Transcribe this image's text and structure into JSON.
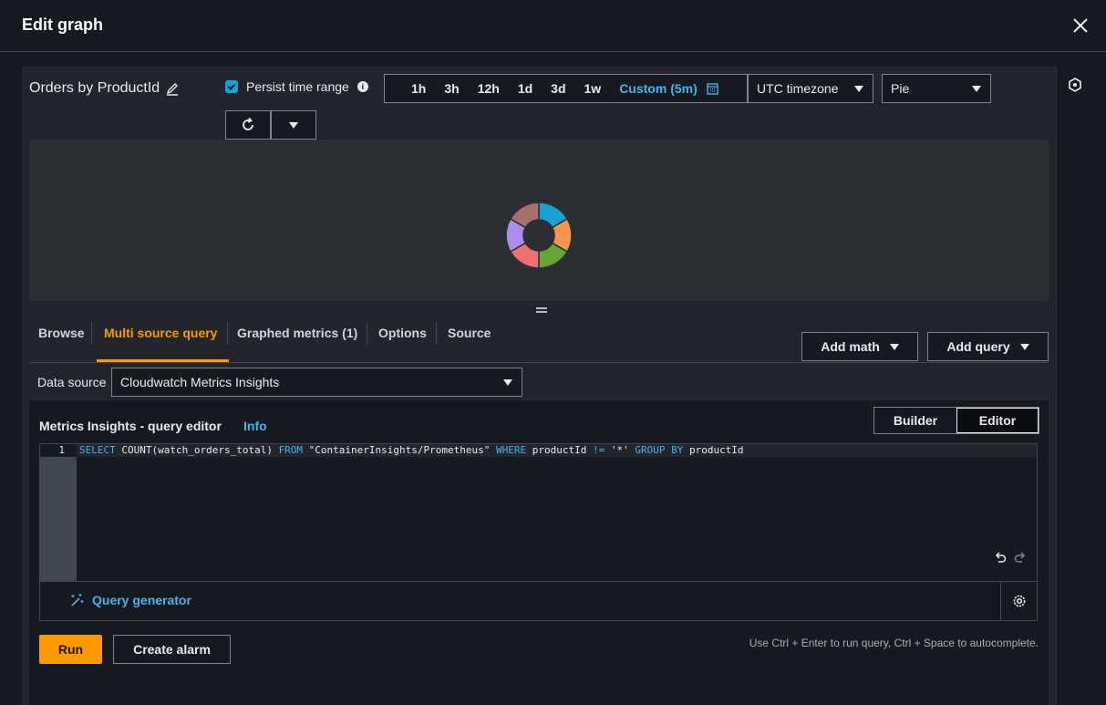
{
  "modal": {
    "title": "Edit graph"
  },
  "graph": {
    "title": "Orders by ProductId"
  },
  "persist": {
    "label": "Persist time range",
    "checked": true
  },
  "time_ranges": [
    "1h",
    "3h",
    "12h",
    "1d",
    "3d",
    "1w"
  ],
  "custom_range": "Custom (5m)",
  "timezone": {
    "selected": "UTC timezone"
  },
  "chart_type": {
    "selected": "Pie"
  },
  "chart_data": {
    "type": "pie",
    "slices": [
      {
        "value": 1,
        "color": "#17a2d3"
      },
      {
        "value": 1,
        "color": "#f5944d"
      },
      {
        "value": 1,
        "color": "#65a637"
      },
      {
        "value": 1,
        "color": "#f36f6f"
      },
      {
        "value": 1,
        "color": "#ad8cef"
      },
      {
        "value": 1,
        "color": "#a8706a"
      }
    ]
  },
  "tabs": [
    {
      "label": "Browse"
    },
    {
      "label": "Multi source query",
      "active": true
    },
    {
      "label": "Graphed metrics (1)"
    },
    {
      "label": "Options"
    },
    {
      "label": "Source"
    }
  ],
  "actions": {
    "add_math": "Add math",
    "add_query": "Add query"
  },
  "data_source": {
    "label": "Data source",
    "selected": "Cloudwatch Metrics Insights"
  },
  "editor": {
    "title": "Metrics Insights - query editor",
    "info": "Info",
    "mode_builder": "Builder",
    "mode_editor": "Editor",
    "line_number": "1",
    "query_parts": {
      "select": "SELECT",
      "fn": " COUNT(watch_orders_total) ",
      "from": "FROM",
      "ns": " \"ContainerInsights/Prometheus\" ",
      "where": "WHERE",
      "field": " productId ",
      "op": "!=",
      "val": " '*' ",
      "group": "GROUP BY",
      "grp_field": " productId"
    },
    "query_generator": "Query generator",
    "run": "Run",
    "create_alarm": "Create alarm",
    "hint": "Use Ctrl + Enter to run query, Ctrl + Space to autocomplete."
  },
  "colors": {
    "accent": "#ff9900",
    "link": "#42b4f1"
  }
}
